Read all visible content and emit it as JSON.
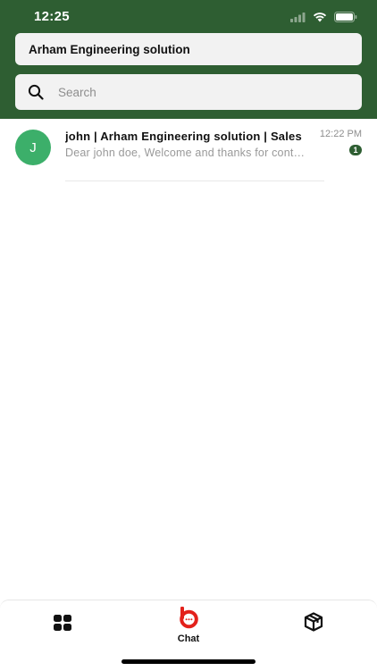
{
  "status_bar": {
    "time": "12:25"
  },
  "header": {
    "company_name": "Arham Engineering solution",
    "search_placeholder": "Search"
  },
  "chats": [
    {
      "avatar_letter": "J",
      "title": "john  |  Arham Engineering solution |  Sales",
      "preview": "Dear john doe, Welcome and thanks for contacting us",
      "time": "12:22 PM",
      "unread_count": "1"
    }
  ],
  "bottom_nav": {
    "items": [
      {
        "icon": "grid-icon",
        "label": ""
      },
      {
        "icon": "chat-logo-icon",
        "label": "Chat"
      },
      {
        "icon": "box-icon",
        "label": ""
      }
    ]
  },
  "colors": {
    "header_bg": "#2e5e32",
    "avatar_bg": "#3caf6a",
    "badge_bg": "#2e5e32",
    "accent_red": "#e3211b"
  }
}
